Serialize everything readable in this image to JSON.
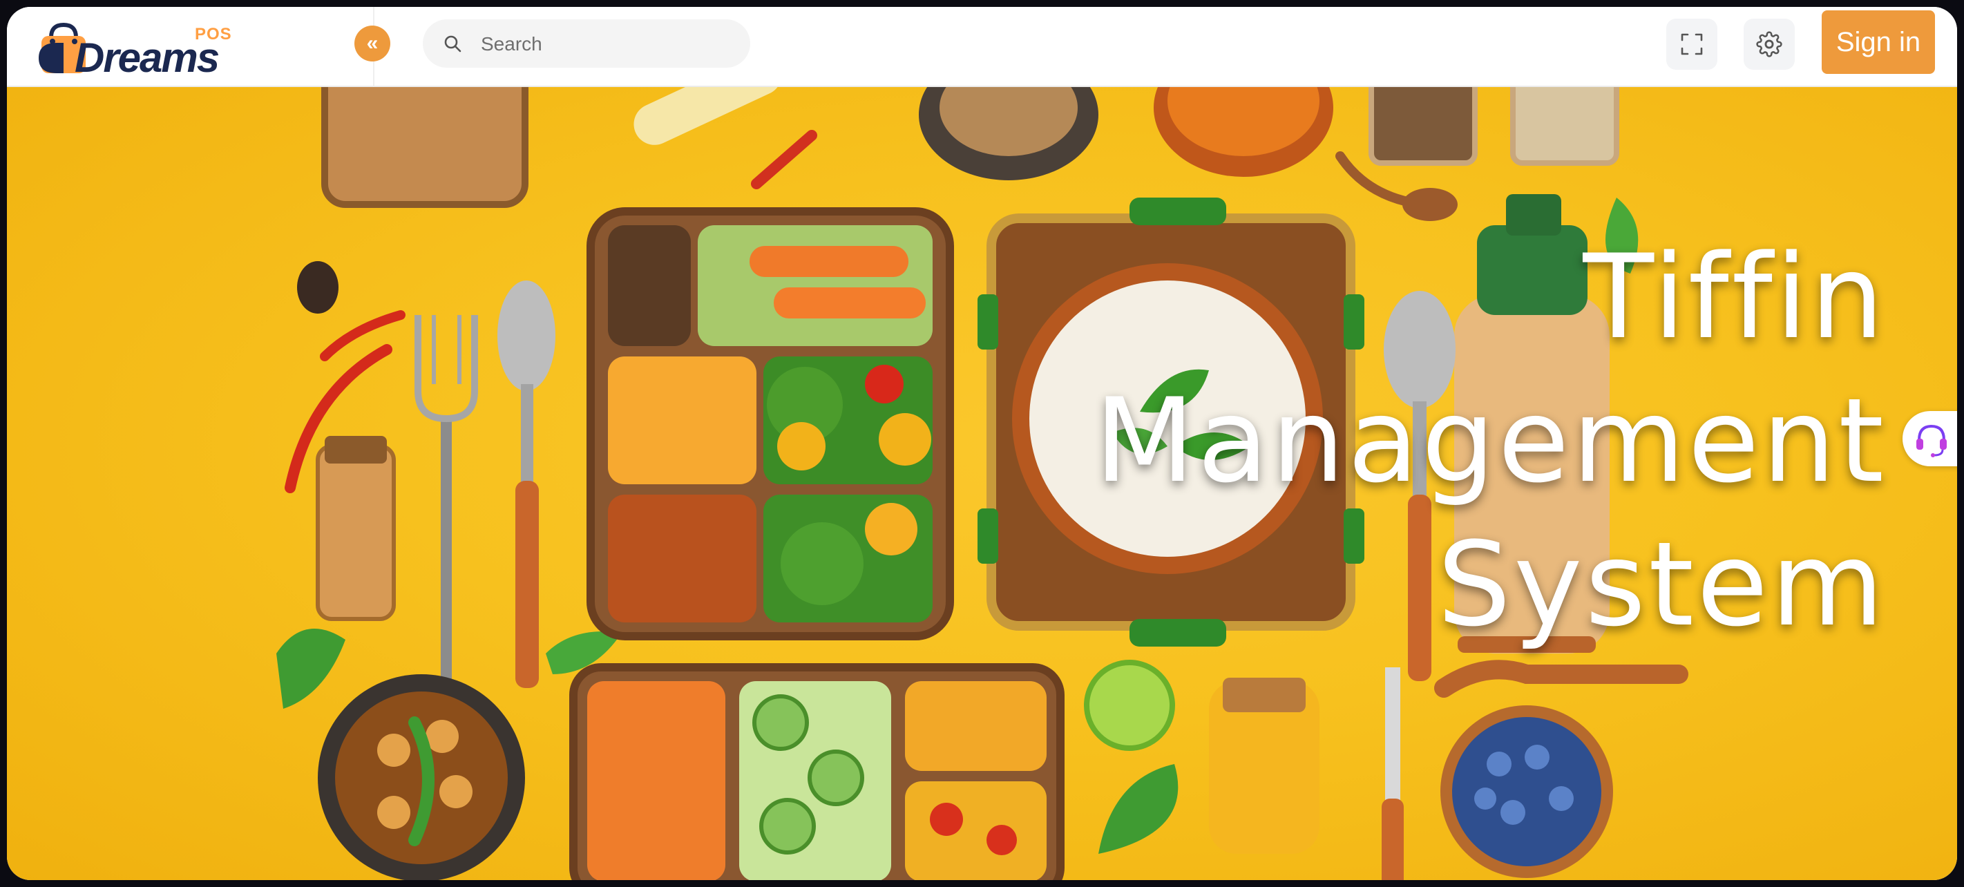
{
  "app": {
    "logo_text": "Dreams",
    "logo_suffix": "POS"
  },
  "header": {
    "collapse_icon": "double-chevron-left-icon",
    "collapse_glyph": "«",
    "search": {
      "placeholder": "Search",
      "value": ""
    },
    "fullscreen_icon": "fullscreen-icon",
    "settings_icon": "gear-icon",
    "signin_label": "Sign in"
  },
  "hero": {
    "title_lines": [
      "Tiffin",
      "Management",
      "System"
    ],
    "background_color": "#f7c11e"
  },
  "support": {
    "icon": "headset-icon"
  },
  "colors": {
    "accent": "#ee9a3c",
    "brand_navy": "#1b2850",
    "hero_yellow": "#f7c11e"
  }
}
